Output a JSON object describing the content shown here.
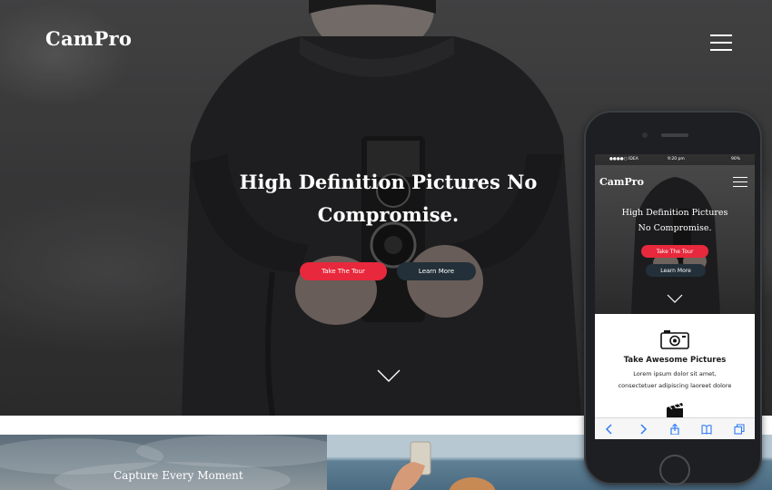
{
  "header": {
    "brand": "CamPro",
    "menu_icon": "hamburger-menu-icon"
  },
  "hero": {
    "title_line1": "High Definition Pictures No",
    "title_line2": "Compromise.",
    "primary_button": "Take The Tour",
    "secondary_button": "Learn More",
    "scroll_icon": "chevron-down-icon"
  },
  "lower_section": {
    "title": "Capture Every Moment"
  },
  "phone": {
    "status": {
      "carrier": "●●●●○ IDEA",
      "time": "9:20 pm",
      "battery": "90%"
    },
    "brand": "CamPro",
    "hero_title_line1": "High Definition Pictures",
    "hero_title_line2": "No Compromise.",
    "primary_button": "Take The Tour",
    "secondary_button": "Learn More",
    "feature": {
      "title": "Take Awesome Pictures",
      "text_line1": "Lorem ipsum dolor sit amet,",
      "text_line2": "consectetuer adipiscing laoreet dolore",
      "icon": "camera-icon"
    },
    "toolbar": [
      "back-icon",
      "forward-icon",
      "share-icon",
      "bookmarks-icon",
      "tabs-icon"
    ]
  },
  "colors": {
    "accent": "#e8283c",
    "secondary_button": "#233039",
    "hero_bg": "#3a3a3a"
  }
}
